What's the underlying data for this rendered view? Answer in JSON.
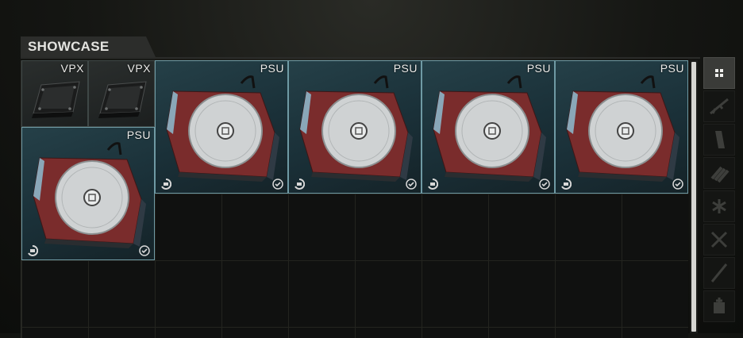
{
  "container": {
    "title": "SHOWCASE"
  },
  "items": [
    {
      "label": "VPX",
      "kind": "vpx"
    },
    {
      "label": "VPX",
      "kind": "vpx"
    },
    {
      "label": "PSU",
      "kind": "psu"
    },
    {
      "label": "PSU",
      "kind": "psu"
    },
    {
      "label": "PSU",
      "kind": "psu"
    },
    {
      "label": "PSU",
      "kind": "psu"
    },
    {
      "label": "PSU",
      "kind": "psu"
    }
  ],
  "sidebar": {
    "filters": [
      {
        "icon": "grid-icon",
        "active": true
      },
      {
        "icon": "rifle-icon",
        "active": false
      },
      {
        "icon": "magazine-icon",
        "active": false
      },
      {
        "icon": "ammo-icon",
        "active": false
      },
      {
        "icon": "medical-icon",
        "active": false
      },
      {
        "icon": "crossed-tools-icon",
        "active": false
      },
      {
        "icon": "knife-icon",
        "active": false
      },
      {
        "icon": "add-container-icon",
        "active": false
      }
    ]
  },
  "colors": {
    "item_border": "#6f9aa4",
    "item_bg": "#1a3038",
    "grid_bg": "#101110"
  }
}
